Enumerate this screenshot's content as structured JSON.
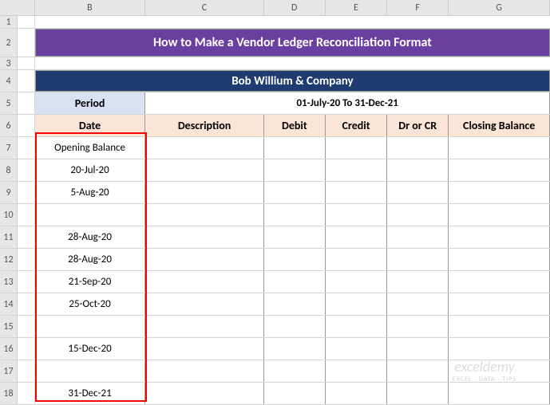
{
  "columns": [
    "A",
    "B",
    "C",
    "D",
    "E",
    "F",
    "G"
  ],
  "rows": [
    "1",
    "2",
    "3",
    "4",
    "5",
    "6",
    "7",
    "8",
    "9",
    "10",
    "11",
    "12",
    "13",
    "14",
    "15",
    "16",
    "17",
    "18"
  ],
  "title": "How to Make a Vendor Ledger Reconciliation Format",
  "company": "Bob Willium & Company",
  "period_label": "Period",
  "period_value": "01-July-20 To 31-Dec-21",
  "headers": {
    "date": "Date",
    "description": "Description",
    "debit": "Debit",
    "credit": "Credit",
    "dr_cr": "Dr or CR",
    "closing": "Closing Balance"
  },
  "data_rows": [
    {
      "date": "Opening Balance",
      "desc": "",
      "debit": "",
      "credit": "",
      "drcr": "",
      "closing": ""
    },
    {
      "date": "20-Jul-20",
      "desc": "",
      "debit": "",
      "credit": "",
      "drcr": "",
      "closing": ""
    },
    {
      "date": "5-Aug-20",
      "desc": "",
      "debit": "",
      "credit": "",
      "drcr": "",
      "closing": ""
    },
    {
      "date": "",
      "desc": "",
      "debit": "",
      "credit": "",
      "drcr": "",
      "closing": ""
    },
    {
      "date": "28-Aug-20",
      "desc": "",
      "debit": "",
      "credit": "",
      "drcr": "",
      "closing": ""
    },
    {
      "date": "28-Aug-20",
      "desc": "",
      "debit": "",
      "credit": "",
      "drcr": "",
      "closing": ""
    },
    {
      "date": "21-Sep-20",
      "desc": "",
      "debit": "",
      "credit": "",
      "drcr": "",
      "closing": ""
    },
    {
      "date": "25-Oct-20",
      "desc": "",
      "debit": "",
      "credit": "",
      "drcr": "",
      "closing": ""
    },
    {
      "date": "",
      "desc": "",
      "debit": "",
      "credit": "",
      "drcr": "",
      "closing": ""
    },
    {
      "date": "15-Dec-20",
      "desc": "",
      "debit": "",
      "credit": "",
      "drcr": "",
      "closing": ""
    },
    {
      "date": "",
      "desc": "",
      "debit": "",
      "credit": "",
      "drcr": "",
      "closing": ""
    },
    {
      "date": "31-Dec-21",
      "desc": "",
      "debit": "",
      "credit": "",
      "drcr": "",
      "closing": ""
    }
  ],
  "watermark": {
    "title": "exceldemy",
    "sub": "EXCEL · DATA · TIPS"
  }
}
